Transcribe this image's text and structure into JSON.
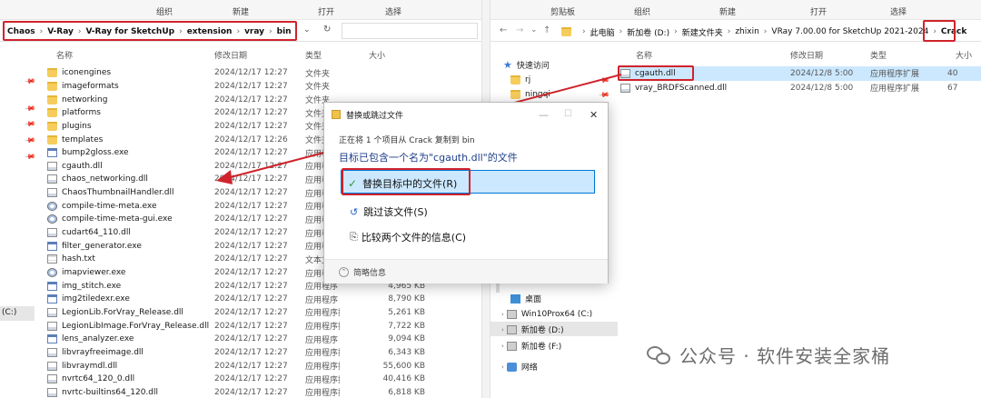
{
  "left_window": {
    "ribbon": [
      "组织",
      "新建",
      "打开",
      "选择"
    ],
    "breadcrumb": [
      "Chaos",
      "V-Ray",
      "V-Ray for SketchUp",
      "extension",
      "vray",
      "bin"
    ],
    "columns": {
      "name": "名称",
      "date": "修改日期",
      "type": "类型",
      "size": "大小"
    },
    "files": [
      {
        "icon": "folder",
        "name": "iconengines",
        "date": "2024/12/17 12:27",
        "type": "文件夹",
        "size": ""
      },
      {
        "icon": "folder",
        "name": "imageformats",
        "date": "2024/12/17 12:27",
        "type": "文件夹",
        "size": ""
      },
      {
        "icon": "folder",
        "name": "networking",
        "date": "2024/12/17 12:27",
        "type": "文件夹",
        "size": ""
      },
      {
        "icon": "folder",
        "name": "platforms",
        "date": "2024/12/17 12:27",
        "type": "文件夹",
        "size": ""
      },
      {
        "icon": "folder",
        "name": "plugins",
        "date": "2024/12/17 12:27",
        "type": "文件夹",
        "size": ""
      },
      {
        "icon": "folder",
        "name": "templates",
        "date": "2024/12/17 12:26",
        "type": "文件夹",
        "size": ""
      },
      {
        "icon": "exe",
        "name": "bump2gloss.exe",
        "date": "2024/12/17 12:27",
        "type": "应用程序",
        "size": ""
      },
      {
        "icon": "dll",
        "name": "cgauth.dll",
        "date": "2024/12/17 12:27",
        "type": "应用程序",
        "size": ""
      },
      {
        "icon": "dll",
        "name": "chaos_networking.dll",
        "date": "2024/12/17 12:27",
        "type": "应用程序",
        "size": ""
      },
      {
        "icon": "dll",
        "name": "ChaosThumbnailHandler.dll",
        "date": "2024/12/17 12:27",
        "type": "应用程序",
        "size": ""
      },
      {
        "icon": "gear",
        "name": "compile-time-meta.exe",
        "date": "2024/12/17 12:27",
        "type": "应用程序",
        "size": ""
      },
      {
        "icon": "gear",
        "name": "compile-time-meta-gui.exe",
        "date": "2024/12/17 12:27",
        "type": "应用程序",
        "size": ""
      },
      {
        "icon": "dll",
        "name": "cudart64_110.dll",
        "date": "2024/12/17 12:27",
        "type": "应用程序",
        "size": ""
      },
      {
        "icon": "exe",
        "name": "filter_generator.exe",
        "date": "2024/12/17 12:27",
        "type": "应用程序",
        "size": ""
      },
      {
        "icon": "txt",
        "name": "hash.txt",
        "date": "2024/12/17 12:27",
        "type": "文本文",
        "size": ""
      },
      {
        "icon": "gear",
        "name": "imapviewer.exe",
        "date": "2024/12/17 12:27",
        "type": "应用程序",
        "size": ""
      },
      {
        "icon": "exe",
        "name": "img_stitch.exe",
        "date": "2024/12/17 12:27",
        "type": "应用程序",
        "size": "4,965 KB"
      },
      {
        "icon": "exe",
        "name": "img2tiledexr.exe",
        "date": "2024/12/17 12:27",
        "type": "应用程序",
        "size": "8,790 KB"
      },
      {
        "icon": "dll",
        "name": "LegionLib.ForVray_Release.dll",
        "date": "2024/12/17 12:27",
        "type": "应用程序扩展",
        "size": "5,261 KB"
      },
      {
        "icon": "dll",
        "name": "LegionLibImage.ForVray_Release.dll",
        "date": "2024/12/17 12:27",
        "type": "应用程序扩展",
        "size": "7,722 KB"
      },
      {
        "icon": "exe",
        "name": "lens_analyzer.exe",
        "date": "2024/12/17 12:27",
        "type": "应用程序",
        "size": "9,094 KB"
      },
      {
        "icon": "dll",
        "name": "libvrayfreeimage.dll",
        "date": "2024/12/17 12:27",
        "type": "应用程序扩展",
        "size": "6,343 KB"
      },
      {
        "icon": "dll",
        "name": "libvraymdl.dll",
        "date": "2024/12/17 12:27",
        "type": "应用程序扩展",
        "size": "55,600 KB"
      },
      {
        "icon": "dll",
        "name": "nvrtc64_120_0.dll",
        "date": "2024/12/17 12:27",
        "type": "应用程序扩展",
        "size": "40,416 KB"
      },
      {
        "icon": "dll",
        "name": "nvrtc-builtins64_120.dll",
        "date": "2024/12/17 12:27",
        "type": "应用程序扩展",
        "size": "6,818 KB"
      }
    ],
    "drive_label": "(C:)"
  },
  "right_window": {
    "ribbon": [
      "剪贴板",
      "组织",
      "新建",
      "打开",
      "选择"
    ],
    "breadcrumb": [
      "此电脑",
      "新加卷 (D:)",
      "新建文件夹",
      "zhixin",
      "VRay 7.00.00 for SketchUp 2021-2024",
      "Crack"
    ],
    "columns": {
      "name": "名称",
      "date": "修改日期",
      "type": "类型",
      "size": "大小"
    },
    "nav": [
      {
        "name": "快速访问",
        "icon": "star"
      },
      {
        "name": "rj",
        "icon": "folder"
      },
      {
        "name": "ningqi",
        "icon": "folder"
      },
      {
        "name": "桌面",
        "icon": "desktop"
      },
      {
        "name": "Win10Prox64 (C:)",
        "icon": "drive"
      },
      {
        "name": "新加卷 (D:)",
        "icon": "drive"
      },
      {
        "name": "新加卷 (F:)",
        "icon": "drive"
      },
      {
        "name": "网络",
        "icon": "network"
      }
    ],
    "files": [
      {
        "icon": "dll",
        "name": "cgauth.dll",
        "date": "2024/12/8 5:00",
        "type": "应用程序扩展",
        "size": "40"
      },
      {
        "icon": "dll",
        "name": "vray_BRDFScanned.dll",
        "date": "2024/12/8 5:00",
        "type": "应用程序扩展",
        "size": "67"
      }
    ]
  },
  "dialog": {
    "title": "替换或跳过文件",
    "subtitle": "正在将 1 个项目从 Crack 复制到 bin",
    "heading": "目标已包含一个名为\"cgauth.dll\"的文件",
    "options": [
      "替换目标中的文件(R)",
      "跳过该文件(S)",
      "比较两个文件的信息(C)"
    ],
    "details": "简略信息"
  },
  "watermark": {
    "text": "公众号 · 软件安装全家桶"
  },
  "colors": {
    "highlight_red": "#d0232b",
    "option_blue": "#cce8ff",
    "option_blue_border": "#0078d7"
  }
}
